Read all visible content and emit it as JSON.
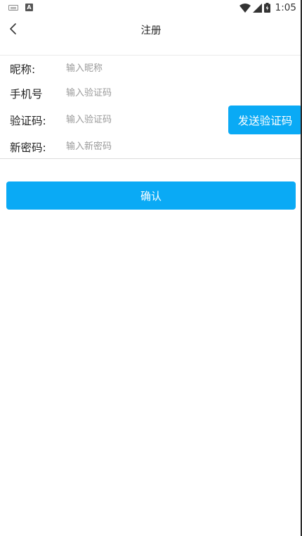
{
  "status_bar": {
    "time": "1:05",
    "icons": [
      "keyboard-icon",
      "a-notification-icon",
      "wifi-icon",
      "signal-icon",
      "battery-icon"
    ]
  },
  "header": {
    "title": "注册",
    "back_icon": "chevron-left-icon"
  },
  "form": {
    "nickname": {
      "label": "昵称:",
      "placeholder": "输入昵称",
      "value": ""
    },
    "phone": {
      "label": "手机号",
      "placeholder": "输入验证码",
      "value": ""
    },
    "code": {
      "label": "验证码:",
      "placeholder": "输入验证码",
      "value": ""
    },
    "new_password": {
      "label": "新密码:",
      "placeholder": "输入新密码",
      "value": ""
    }
  },
  "buttons": {
    "send_code": "发送验证码",
    "confirm": "确认"
  },
  "colors": {
    "accent": "#0aaaf5",
    "background": "#ffffff",
    "placeholder": "#9a9a9a",
    "divider": "#dcdcdc"
  }
}
